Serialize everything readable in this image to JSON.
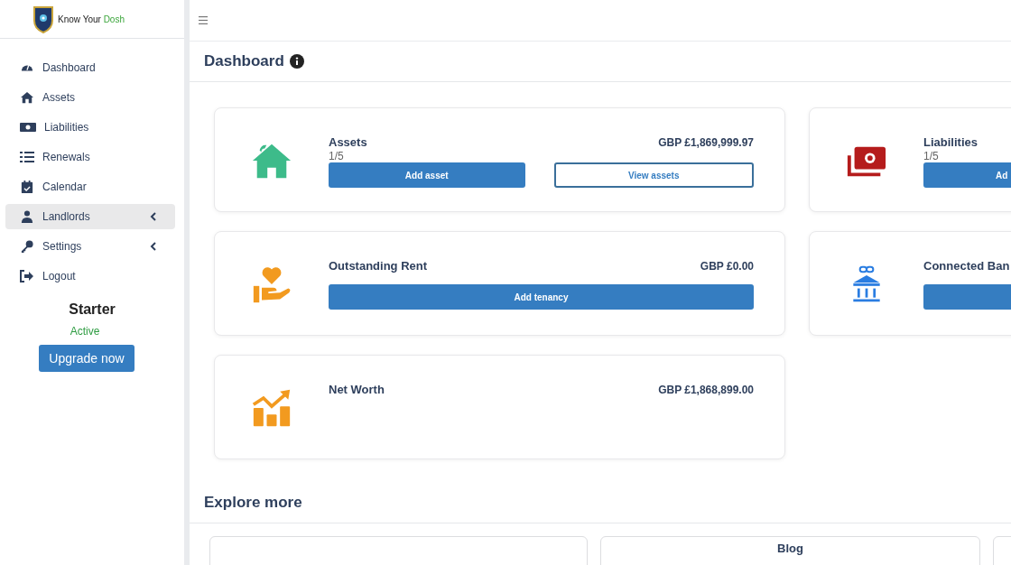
{
  "brand": {
    "name_part_1": "Know Your",
    "name_part_2": "Dosh"
  },
  "sidebar": {
    "items": [
      {
        "label": "Dashboard",
        "selected": false,
        "has_submenu": false
      },
      {
        "label": "Assets",
        "selected": false,
        "has_submenu": false
      },
      {
        "label": "Liabilities",
        "selected": false,
        "has_submenu": false
      },
      {
        "label": "Renewals",
        "selected": false,
        "has_submenu": false
      },
      {
        "label": "Calendar",
        "selected": false,
        "has_submenu": false
      },
      {
        "label": "Landlords",
        "selected": true,
        "has_submenu": true
      },
      {
        "label": "Settings",
        "selected": false,
        "has_submenu": true
      },
      {
        "label": "Logout",
        "selected": false,
        "has_submenu": false
      }
    ]
  },
  "plan": {
    "name": "Starter",
    "status": "Active",
    "button": "Upgrade now"
  },
  "page": {
    "title": "Dashboard"
  },
  "cards": [
    {
      "title": "Assets",
      "count": "1/5",
      "amount": "GBP £1,869,999.97",
      "buttons": [
        {
          "label": "Add asset",
          "kind": "primary"
        },
        {
          "label": "View assets",
          "kind": "outline"
        }
      ]
    },
    {
      "title": "Liabilities",
      "count": "1/5",
      "buttons": [
        {
          "label": "Ad",
          "kind": "primary"
        }
      ]
    },
    {
      "title": "Outstanding Rent",
      "amount": "GBP £0.00",
      "buttons": [
        {
          "label": "Add tenancy",
          "kind": "primary"
        }
      ]
    },
    {
      "title": "Connected Ban",
      "buttons": [
        {
          "kind": "primary"
        }
      ]
    },
    {
      "title": "Net Worth",
      "amount": "GBP £1,868,899.00"
    }
  ],
  "explore": {
    "title": "Explore more",
    "card_title": "Blog"
  }
}
